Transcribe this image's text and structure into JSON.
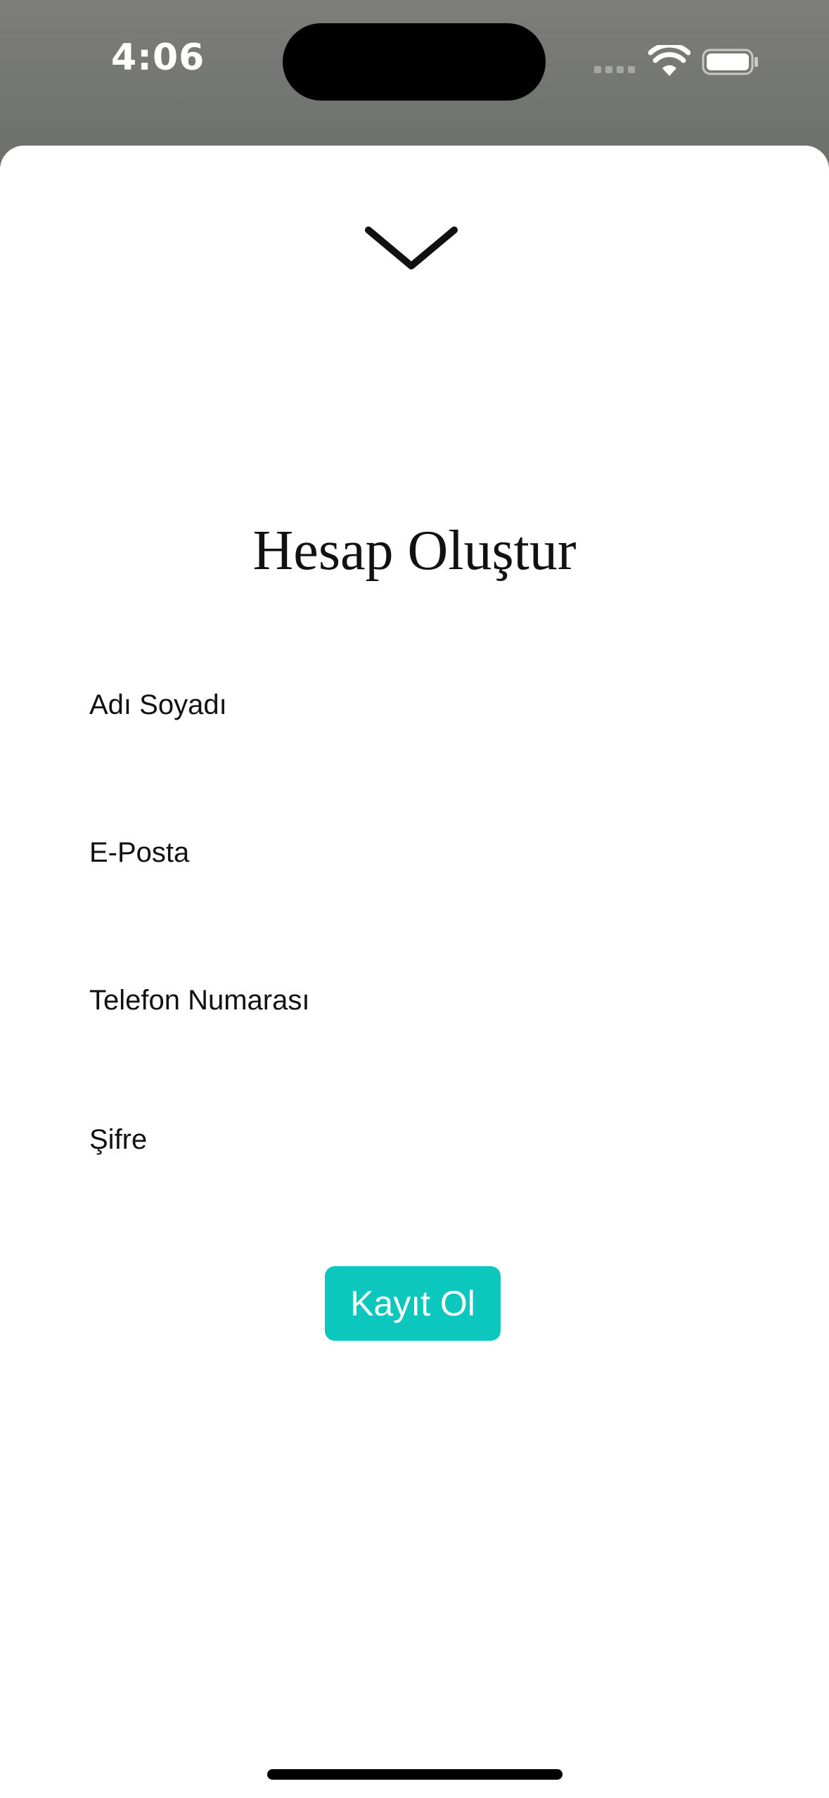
{
  "status_bar": {
    "time": "4:06",
    "icons": [
      "cellular-signal-icon",
      "wifi-icon",
      "battery-icon"
    ]
  },
  "sheet": {
    "dismiss_icon": "chevron-down-icon",
    "title": "Hesap Oluştur",
    "fields": [
      {
        "label": "Adı Soyadı"
      },
      {
        "label": "E-Posta"
      },
      {
        "label": "Telefon Numarası"
      },
      {
        "label": "Şifre"
      }
    ],
    "submit_label": "Kayıt Ol"
  },
  "colors": {
    "accent": "#0cc7bd",
    "sheet_background": "#ffffff",
    "backdrop": "#747574"
  }
}
